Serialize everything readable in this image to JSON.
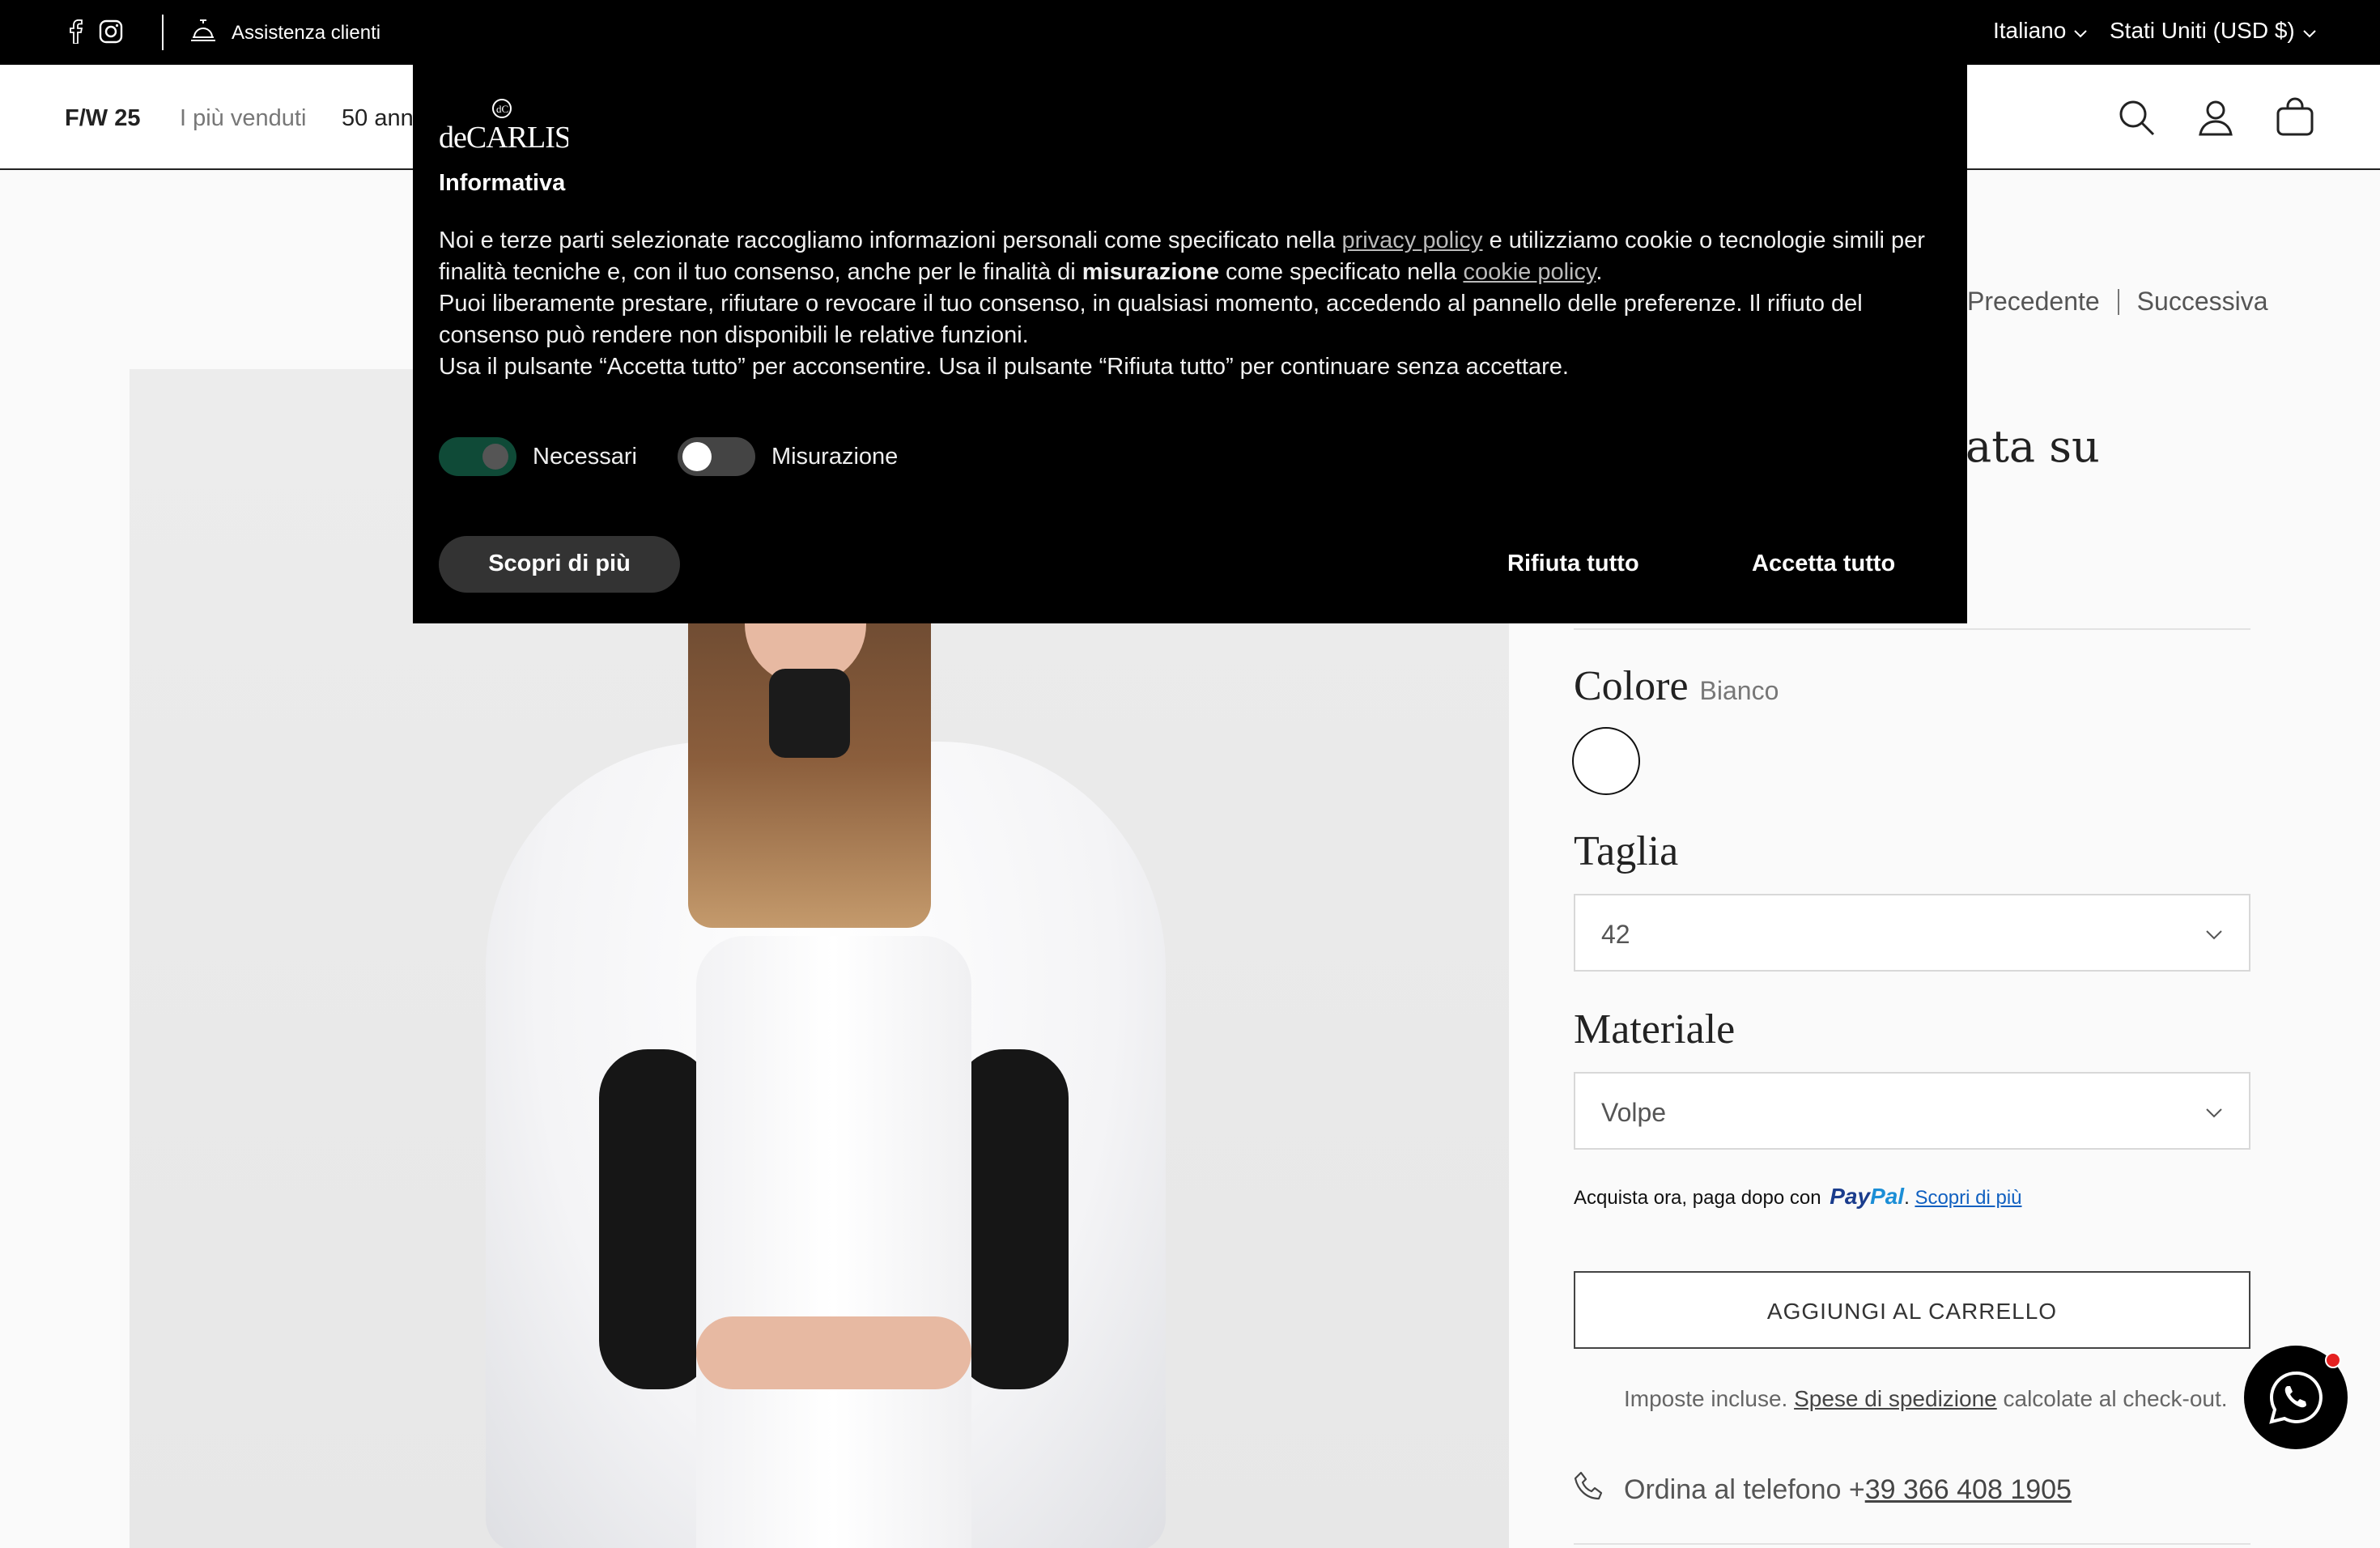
{
  "topbar": {
    "support_label": "Assistenza clienti",
    "promo_text": "",
    "language": "Italiano",
    "country": "Stati Uniti (USD $)"
  },
  "nav": {
    "items": [
      "F/W 25",
      "I più venduti",
      "50 ann"
    ]
  },
  "pager": {
    "prev": "Precedente",
    "next": "Successiva"
  },
  "product": {
    "title_fragment": "ata su",
    "color_label": "Colore",
    "color_value": "Bianco",
    "size_label": "Taglia",
    "size_value": "42",
    "material_label": "Materiale",
    "material_value": "Volpe",
    "paypal": {
      "prefix": "Acquista ora, paga dopo con",
      "brand_a": "Pay",
      "brand_b": "Pal",
      "link": "Scopri di più"
    },
    "add_to_cart": "AGGIUNGI AL CARRELLO",
    "taxes": {
      "pre": "Imposte incluse.",
      "link": "Spese di spedizione",
      "post": "calcolate al check-out."
    },
    "phone": {
      "label": "Ordina al telefono +",
      "number": "39 366 408 1905"
    }
  },
  "cookie_modal": {
    "logo_text": "deCARLIS",
    "heading": "Informativa",
    "p1_a": "Noi e terze parti selezionate raccogliamo informazioni personali come specificato nella ",
    "p1_link1": "privacy policy",
    "p1_b": " e utilizziamo cookie o tecnologie simili per finalità tecniche e, con il tuo consenso, anche per le finalità di ",
    "p1_bold": "misurazione",
    "p1_c": " come specificato nella ",
    "p1_link2": "cookie policy",
    "p1_d": ".",
    "p2": "Puoi liberamente prestare, rifiutare o revocare il tuo consenso, in qualsiasi momento, accedendo al pannello delle preferenze. Il rifiuto del consenso può rendere non disponibili le relative funzioni.",
    "p3": "Usa il pulsante “Accetta tutto” per acconsentire. Usa il pulsante “Rifiuta tutto” per continuare senza accettare.",
    "toggles": [
      {
        "label": "Necessari",
        "state": "on"
      },
      {
        "label": "Misurazione",
        "state": "off"
      }
    ],
    "learn_more": "Scopri di più",
    "reject_all": "Rifiuta tutto",
    "accept_all": "Accetta tutto"
  },
  "icons": [
    "facebook-icon",
    "instagram-icon",
    "bell-icon",
    "chevron-down-icon",
    "search-icon",
    "account-icon",
    "cart-icon",
    "phone-icon",
    "whatsapp-icon"
  ],
  "colors": {
    "toggle_on": "#0f4a37",
    "paypal_dark": "#1a3c8c",
    "paypal_light": "#1b8ed6",
    "notify_dot": "#e52020"
  }
}
